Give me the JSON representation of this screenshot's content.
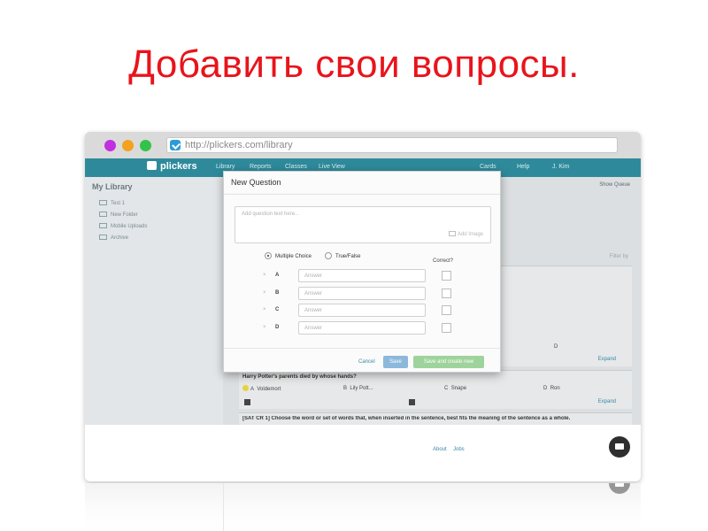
{
  "slide": {
    "title": "Добавить свои вопросы."
  },
  "browser": {
    "url": "http://plickers.com/library",
    "window_dots": [
      "#c32ee0",
      "#f2a21e",
      "#34c34a"
    ]
  },
  "nav": {
    "logo": "plickers",
    "items": [
      "Library",
      "Reports",
      "Classes",
      "Live View",
      "Cards",
      "Help",
      "J. Kim"
    ]
  },
  "sidebar": {
    "title": "My Library",
    "items": [
      "Test 1",
      "New Folder",
      "Mobile Uploads",
      "Archive"
    ]
  },
  "main": {
    "show_queue": "Show Queue",
    "filter_by": "Filter by",
    "card1": {
      "choice_d": "D",
      "expand": "Expand"
    },
    "card2": {
      "question": "Harry Potter's parents died by whose hands?",
      "choices": [
        {
          "letter": "A",
          "text": "Voldemort"
        },
        {
          "letter": "B",
          "text": "Lily Pott..."
        },
        {
          "letter": "C",
          "text": "Snape"
        },
        {
          "letter": "D",
          "text": "Ron"
        }
      ],
      "expand": "Expand"
    },
    "card3": {
      "question": "[SAT CR 1] Choose the word or set of words that, when inserted in the sentence, best fits the meaning of the sentence as a whole."
    }
  },
  "footer": {
    "about": "About",
    "jobs": "Jobs"
  },
  "modal": {
    "title": "New Question",
    "question_placeholder": "Add question text here...",
    "add_image": "Add Image",
    "type_multiple_choice": "Multiple Choice",
    "type_true_false": "True/False",
    "correct_label": "Correct?",
    "answers": [
      {
        "letter": "A",
        "placeholder": "Answer"
      },
      {
        "letter": "B",
        "placeholder": "Answer"
      },
      {
        "letter": "C",
        "placeholder": "Answer"
      },
      {
        "letter": "D",
        "placeholder": "Answer"
      }
    ],
    "remove_glyph": "×",
    "cancel": "Cancel",
    "save": "Save",
    "save_and_create_new": "Save and create new"
  },
  "colors": {
    "title_red": "#e8141c",
    "nav_teal": "#2e8a9b",
    "save_blue": "#8cb8dc",
    "save_new_green": "#9ed39c"
  }
}
